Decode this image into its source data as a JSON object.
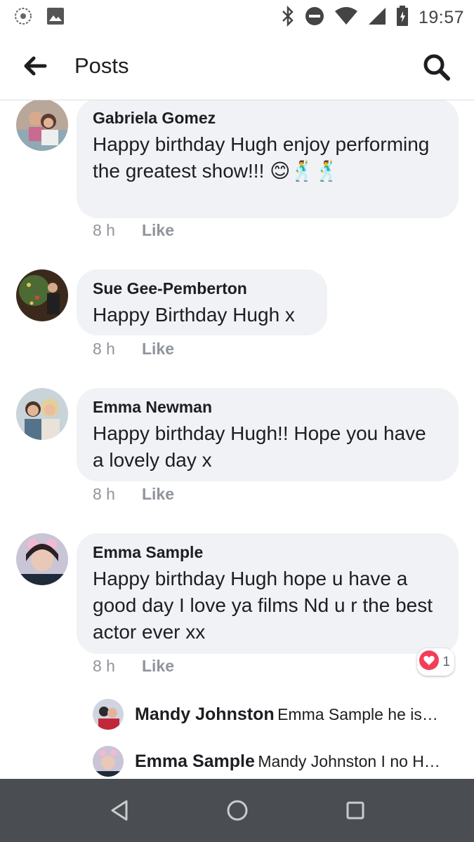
{
  "status_bar": {
    "time": "19:57",
    "icons": [
      "notification-app-icon",
      "image-notification-icon",
      "bluetooth-icon",
      "do-not-disturb-icon",
      "wifi-icon",
      "signal-icon",
      "battery-icon"
    ]
  },
  "header": {
    "title": "Posts",
    "back_icon": "arrow-left-icon",
    "search_icon": "search-icon"
  },
  "comments": [
    {
      "author": "Gabriela Gomez",
      "text": "Happy birthday Hugh enjoy performing the greatest show!!! 😊🕺🕺",
      "time": "8 h",
      "like_label": "Like"
    },
    {
      "author": "Sue Gee-Pemberton",
      "text": "Happy Birthday Hugh x",
      "time": "8 h",
      "like_label": "Like"
    },
    {
      "author": "Emma Newman",
      "text": "Happy birthday Hugh!! Hope you have a lovely day x",
      "time": "8 h",
      "like_label": "Like"
    },
    {
      "author": "Emma Sample",
      "text": "Happy birthday Hugh hope u have a good day I love ya films Nd u  r the best actor ever xx",
      "time": "8 h",
      "like_label": "Like",
      "reaction_icon": "heart-reaction-icon",
      "reaction_count": "1"
    }
  ],
  "replies": [
    {
      "author": "Mandy Johnston",
      "text": "Emma Sample he is…"
    },
    {
      "author": "Emma Sample",
      "text": "Mandy Johnston I no H…"
    }
  ],
  "nav_bar": {
    "buttons": [
      "back-triangle-icon",
      "home-circle-icon",
      "recents-square-icon"
    ]
  },
  "colors": {
    "bubble": "#f0f2f5",
    "meta_text": "#90949c",
    "nav_bar": "#4a4d51",
    "heart": "#f33e58"
  }
}
